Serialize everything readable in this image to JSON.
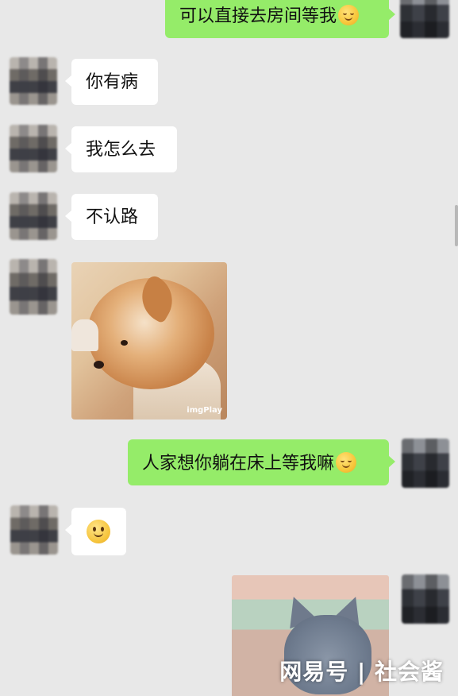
{
  "messages": [
    {
      "side": "right",
      "type": "text",
      "text": "可以直接去房间等我",
      "emoji": "face-emoji"
    },
    {
      "side": "left",
      "type": "text",
      "text": "你有病"
    },
    {
      "side": "left",
      "type": "text",
      "text": "我怎么去"
    },
    {
      "side": "left",
      "type": "text",
      "text": "不认路"
    },
    {
      "side": "left",
      "type": "image",
      "image": "shiba-dog-gif",
      "caption": "imgPlay"
    },
    {
      "side": "right",
      "type": "text",
      "text": "人家想你躺在床上等我嘛",
      "emoji": "face-emoji"
    },
    {
      "side": "left",
      "type": "emoji",
      "emoji": "smile-emoji"
    },
    {
      "side": "right",
      "type": "image",
      "image": "tom-cat-gif"
    }
  ],
  "watermark": "网易号 | 社会酱",
  "colors": {
    "background": "#e8e8e8",
    "left_bubble": "#ffffff",
    "right_bubble": "#95ec69"
  }
}
